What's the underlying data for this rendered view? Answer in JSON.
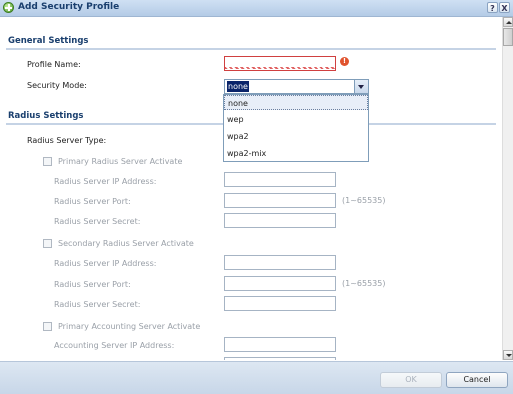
{
  "window": {
    "title": "Add Security Profile",
    "help_label": "?",
    "close_label": "X"
  },
  "general": {
    "header": "General Settings",
    "profile_name_label": "Profile Name:",
    "profile_name_value": "",
    "error_icon": "!",
    "security_mode_label": "Security Mode:",
    "security_mode_value": "none",
    "security_mode_options": [
      "none",
      "wep",
      "wpa2",
      "wpa2-mix"
    ]
  },
  "radius": {
    "header": "Radius Settings",
    "server_type_label": "Radius Server Type:",
    "primary_activate_label": "Primary Radius Server Activate",
    "secondary_activate_label": "Secondary Radius Server Activate",
    "accounting_activate_label": "Primary Accounting Server Activate",
    "ip_label": "Radius Server IP Address:",
    "port_label": "Radius Server Port:",
    "secret_label": "Radius Server Secret:",
    "accounting_ip_label": "Accounting Server IP Address:",
    "port_hint": "(1~65535)"
  },
  "footer": {
    "ok_label": "OK",
    "cancel_label": "Cancel"
  },
  "icons": {
    "title_icon": "add-circle-icon",
    "error_icon": "warning-icon"
  }
}
